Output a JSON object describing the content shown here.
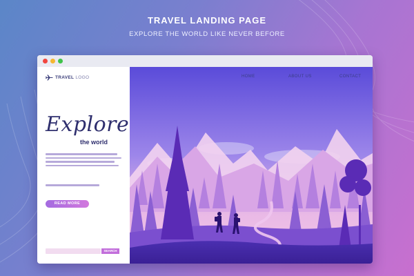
{
  "header": {
    "title": "TRAVEL LANDING PAGE",
    "subtitle": "EXPLORE THE WORLD LIKE NEVER BEFORE"
  },
  "window": {
    "controls": [
      "close",
      "minimize",
      "maximize"
    ],
    "control_colors": [
      "#f2463f",
      "#f5b731",
      "#3fc34a"
    ]
  },
  "logo": {
    "icon": "airplane-icon",
    "text": "TRAVEL",
    "text_light": "LOGO"
  },
  "nav": {
    "items": [
      "HOME",
      "ABOUT US",
      "CONTACT"
    ]
  },
  "hero": {
    "headline": "Explore",
    "tagline": "the world",
    "cta_label": "READ MORE",
    "search_placeholder": "",
    "search_button": "SEARCH"
  },
  "colors": {
    "accent": "#c26edb",
    "navy": "#2f2f6e",
    "sky_top": "#5a4bd9",
    "sky_bottom": "#f4c8e4"
  }
}
